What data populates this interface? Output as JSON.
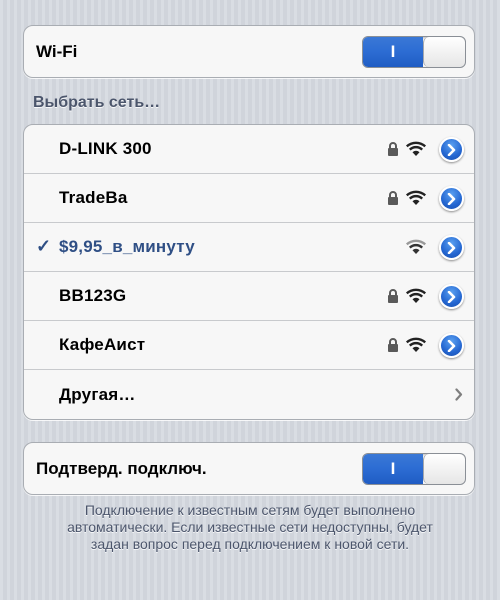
{
  "wifi": {
    "label": "Wi-Fi",
    "toggle_on_text": "I",
    "enabled": true
  },
  "networks_header": "Выбрать сеть…",
  "networks": [
    {
      "name": "D-LINK  300",
      "selected": false,
      "locked": true
    },
    {
      "name": "TradeBa",
      "selected": false,
      "locked": true
    },
    {
      "name": "$9,95_в_минуту",
      "selected": true,
      "locked": false
    },
    {
      "name": "BB123G",
      "selected": false,
      "locked": true
    },
    {
      "name": "КафеАист",
      "selected": false,
      "locked": true
    }
  ],
  "check_mark": "✓",
  "other_label": "Другая…",
  "ask_join": {
    "label": "Подтверд. подключ.",
    "toggle_on_text": "I",
    "enabled": true
  },
  "footer_text": "Подключение к известным сетям будет выполнено автоматически. Если известные сети недоступны, будет задан вопрос перед подключением к новой сети.",
  "colors": {
    "accent": "#2c6cd3",
    "selected_text": "#2f4f85",
    "header_text": "#4c566c"
  },
  "icons": {
    "lock": "lock-icon",
    "wifi": "wifi-icon",
    "detail": "detail-disclosure-icon",
    "chevron": "chevron-right-icon"
  }
}
